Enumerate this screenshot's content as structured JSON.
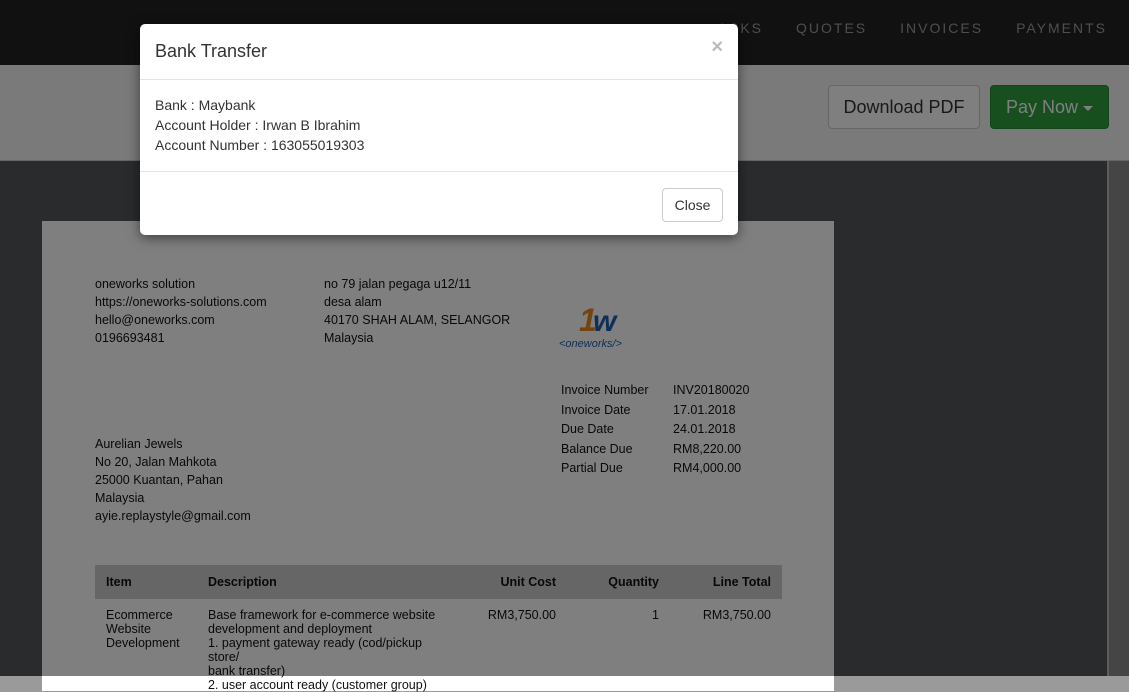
{
  "nav": {
    "items": [
      "ASKS",
      "QUOTES",
      "INVOICES",
      "PAYMENTS"
    ]
  },
  "toolbar": {
    "download_pdf": "Download PDF",
    "pay_now": "Pay Now"
  },
  "invoice": {
    "company": {
      "name": "oneworks solution",
      "website": "https://oneworks-solutions.com",
      "email": "hello@oneworks.com",
      "phone": "0196693481"
    },
    "address": {
      "line1": "no 79 jalan pegaga u12/11",
      "line2": "desa alam",
      "line3": "40170 SHAH ALAM, SELANGOR",
      "country": "Malaysia"
    },
    "logo": {
      "mark": "1W",
      "text": "<oneworks/>"
    },
    "client": {
      "name": "Aurelian Jewels",
      "line1": "No 20, Jalan Mahkota",
      "line2": "25000 Kuantan, Pahan",
      "country": "Malaysia",
      "email": "ayie.replaystyle@gmail.com"
    },
    "meta": [
      {
        "label": "Invoice Number",
        "value": "INV20180020"
      },
      {
        "label": "Invoice Date",
        "value": "17.01.2018"
      },
      {
        "label": "Due Date",
        "value": "24.01.2018"
      },
      {
        "label": "Balance Due",
        "value": "RM8,220.00"
      },
      {
        "label": "Partial Due",
        "value": "RM4,000.00"
      }
    ],
    "table": {
      "headers": {
        "item": "Item",
        "description": "Description",
        "unit_cost": "Unit Cost",
        "quantity": "Quantity",
        "line_total": "Line Total"
      },
      "rows": [
        {
          "item_lines": [
            "Ecommerce",
            "Website",
            "Development"
          ],
          "desc_lines": [
            "Base framework for e-commerce website",
            "development and deployment",
            "1. payment gateway ready (cod/pickup store/",
            "bank transfer)",
            "2. user account ready (customer group)"
          ],
          "unit_cost": "RM3,750.00",
          "quantity": "1",
          "line_total": "RM3,750.00"
        }
      ]
    }
  },
  "modal": {
    "title": "Bank Transfer",
    "close_symbol": "×",
    "bank": "Bank : Maybank",
    "holder": "Account Holder : Irwan B Ibrahim",
    "account": "Account Number : 163055019303",
    "close_button": "Close"
  },
  "colors": {
    "nav_bg": "#222222",
    "pay_green": "#2e9e3e",
    "logo_orange": "#e8891c",
    "logo_blue": "#1f5fb0"
  }
}
